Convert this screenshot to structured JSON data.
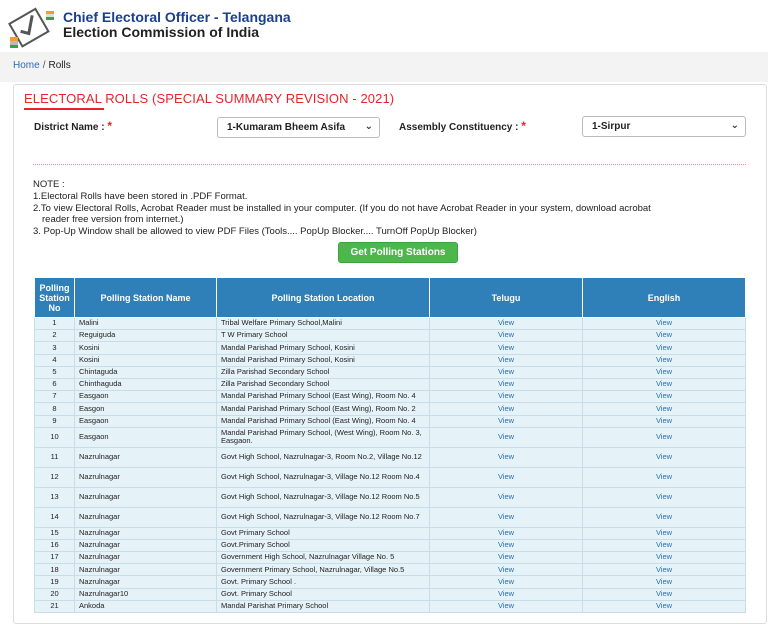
{
  "header": {
    "title_line1": "Chief Electoral Officer - Telangana",
    "title_line2": "Election Commission of India",
    "logo_icon": "eci-ballot-logo-icon"
  },
  "breadcrumb": {
    "home": "Home",
    "separator": "/",
    "current": "Rolls"
  },
  "page": {
    "title": "ELECTORAL ROLLS (SPECIAL SUMMARY REVISION - 2021)",
    "accent_color": "#e8232a"
  },
  "filters": {
    "district_label": "District Name :",
    "district_value": "1-Kumaram Bheem Asifa",
    "constituency_label": "Assembly Constituency :",
    "constituency_value": "1-Sirpur",
    "required_mark": "*"
  },
  "note": {
    "heading": "NOTE :",
    "line1": "1.Electoral Rolls have been stored in .PDF Format.",
    "line2a": "2.To view Electoral Rolls, Acrobat Reader must be installed in your computer. (If you do not have Acrobat Reader in your system, download acrobat",
    "line2b": "reader free version from internet.)",
    "line3": "3. Pop-Up Window shall be allowed to view PDF Files (Tools.... PopUp Blocker.... TurnOff PopUp Blocker)"
  },
  "button": {
    "get_label": "Get Polling Stations",
    "color": "#4cb84c"
  },
  "table": {
    "header_color": "#2f7fb8",
    "columns": {
      "no": "Polling Station No",
      "name": "Polling Station Name",
      "location": "Polling Station Location",
      "telugu": "Telugu",
      "english": "English"
    },
    "rows": [
      {
        "no": "1",
        "name": "Malini",
        "location": "Tribal Welfare Primary School,Malini",
        "telugu": "View",
        "english": "View"
      },
      {
        "no": "2",
        "name": "Reguiguda",
        "location": "T W Primary School",
        "telugu": "View",
        "english": "View"
      },
      {
        "no": "3",
        "name": "Kosini",
        "location": "Mandal Parishad Primary School, Kosini",
        "telugu": "View",
        "english": "View"
      },
      {
        "no": "4",
        "name": "Kosini",
        "location": "Mandal Parishad Primary School, Kosini",
        "telugu": "View",
        "english": "View"
      },
      {
        "no": "5",
        "name": "Chintaguda",
        "location": "Zilla Parishad Secondary School",
        "telugu": "View",
        "english": "View"
      },
      {
        "no": "6",
        "name": "Chinthaguda",
        "location": "Zilla Parishad Secondary School",
        "telugu": "View",
        "english": "View"
      },
      {
        "no": "7",
        "name": "Easgaon",
        "location": "Mandal Parishad Primary School (East Wing), Room No. 4",
        "telugu": "View",
        "english": "View"
      },
      {
        "no": "8",
        "name": "Easgon",
        "location": "Mandal Parishad Primary School (East Wing), Room No. 2",
        "telugu": "View",
        "english": "View"
      },
      {
        "no": "9",
        "name": "Easgaon",
        "location": "Mandal Parishad Primary School (East Wing), Room No. 4",
        "telugu": "View",
        "english": "View"
      },
      {
        "no": "10",
        "name": "Easgaon",
        "location": "Mandal Parishad Primary School, (West Wing), Room No. 3, Easgaon.",
        "telugu": "View",
        "english": "View"
      },
      {
        "no": "11",
        "name": "Nazrulnagar",
        "location": "Govt High School, Nazrulnagar-3, Room No.2, Village No.12",
        "telugu": "View",
        "english": "View"
      },
      {
        "no": "12",
        "name": "Nazrulnagar",
        "location": "Govt High School, Nazrulnagar-3, Village No.12 Room No.4",
        "telugu": "View",
        "english": "View"
      },
      {
        "no": "13",
        "name": "Nazrulnagar",
        "location": "Govt High School, Nazrulnagar-3, Village No.12 Room No.5",
        "telugu": "View",
        "english": "View"
      },
      {
        "no": "14",
        "name": "Nazrulnagar",
        "location": "Govt High School, Nazrulnagar-3, Village No.12 Room No.7",
        "telugu": "View",
        "english": "View"
      },
      {
        "no": "15",
        "name": "Nazrulnagar",
        "location": "Govt Primary School",
        "telugu": "View",
        "english": "View"
      },
      {
        "no": "16",
        "name": "Nazrulnagar",
        "location": "Govt.Primary School",
        "telugu": "View",
        "english": "View"
      },
      {
        "no": "17",
        "name": "Nazrulnagar",
        "location": "Government High School, Nazrulnagar Village No. 5",
        "telugu": "View",
        "english": "View"
      },
      {
        "no": "18",
        "name": "Nazrulnagar",
        "location": "Government Primary School, Nazrulnagar, Village No.5",
        "telugu": "View",
        "english": "View"
      },
      {
        "no": "19",
        "name": "Nazrulnagar",
        "location": "Govt. Primary School .",
        "telugu": "View",
        "english": "View"
      },
      {
        "no": "20",
        "name": "Nazrulnagar10",
        "location": "Govt. Primary School",
        "telugu": "View",
        "english": "View"
      },
      {
        "no": "21",
        "name": "Ankoda",
        "location": "Mandal Parishat Primary School",
        "telugu": "View",
        "english": "View"
      }
    ]
  }
}
